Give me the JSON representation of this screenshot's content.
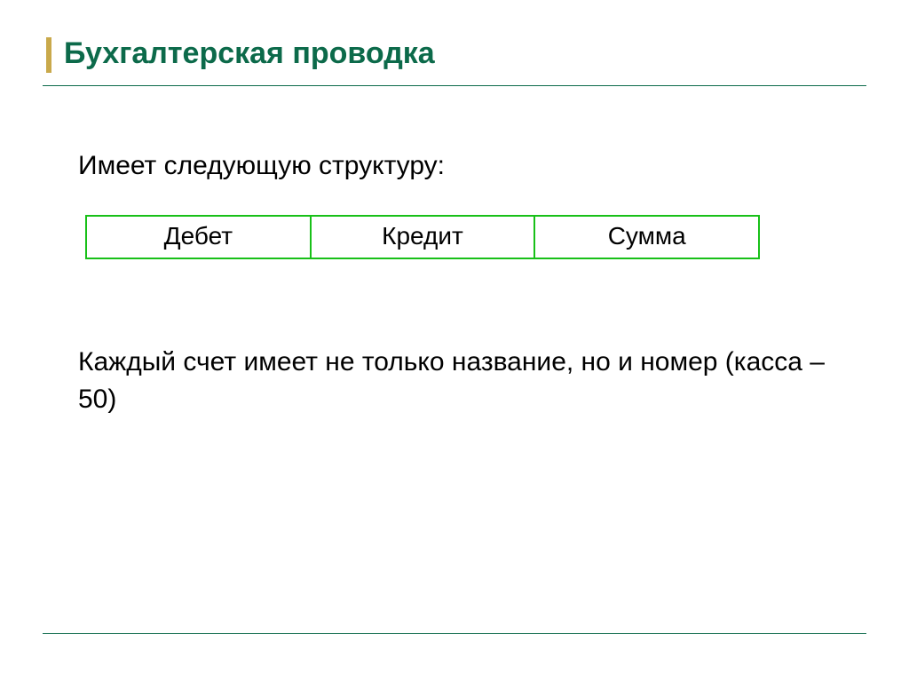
{
  "slide": {
    "title": "Бухгалтерская проводка",
    "intro": "Имеет следующую структуру:",
    "structure": {
      "col1": "Дебет",
      "col2": "Кредит",
      "col3": "Сумма"
    },
    "note": "Каждый счет имеет не только название, но  и номер (касса – 50)"
  }
}
